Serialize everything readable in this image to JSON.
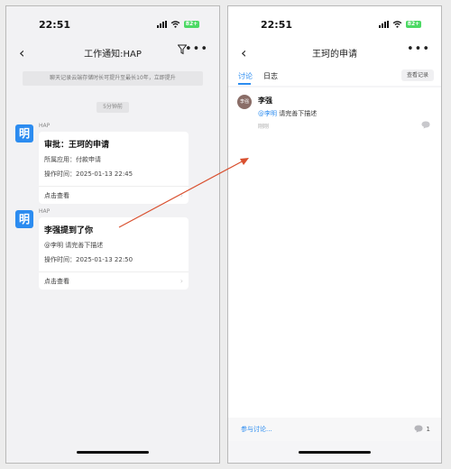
{
  "left": {
    "status": {
      "time": "22:51",
      "battery": "82+"
    },
    "nav": {
      "title": "工作通知:HAP"
    },
    "banner": "聊天记录云端存储时长可提升至最长10年，立即提升",
    "time_divider": "5分钟前",
    "messages": [
      {
        "avatar": "明",
        "sender": "HAP",
        "title": "审批：王珂的申请",
        "lines": [
          "所属应用：付款申请",
          "操作时间：2025-01-13 22:45"
        ],
        "action": "点击查看"
      },
      {
        "avatar": "明",
        "sender": "HAP",
        "title": "李强提到了你",
        "lines": [
          "@李明 请完善下描述",
          "操作时间：2025-01-13 22:50"
        ],
        "action": "点击查看"
      }
    ]
  },
  "right": {
    "status": {
      "time": "22:51",
      "battery": "82+"
    },
    "nav": {
      "title": "王珂的申请"
    },
    "tabs": [
      "讨论",
      "日志"
    ],
    "view_log": "查看记录",
    "comment": {
      "avatar": "李强",
      "name": "李强",
      "mention": "@李明",
      "text": " 请完善下描述",
      "time": "刚刚"
    },
    "footer": {
      "join": "参与讨论...",
      "count": "1"
    }
  },
  "colors": {
    "accent": "#2c8cf0",
    "arrow": "#d9502f"
  }
}
